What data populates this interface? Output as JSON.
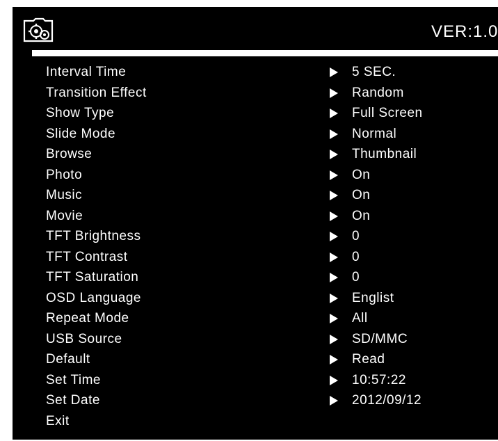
{
  "header": {
    "icon": "settings-gear-icon",
    "version_text": "VER:1.0"
  },
  "menu": {
    "items": [
      {
        "label": "Interval Time",
        "value": "5 SEC."
      },
      {
        "label": "Transition Effect",
        "value": "Random"
      },
      {
        "label": "Show Type",
        "value": "Full Screen"
      },
      {
        "label": "Slide Mode",
        "value": "Normal"
      },
      {
        "label": "Browse",
        "value": "Thumbnail"
      },
      {
        "label": "Photo",
        "value": "On"
      },
      {
        "label": "Music",
        "value": "On"
      },
      {
        "label": "Movie",
        "value": "On"
      },
      {
        "label": "TFT Brightness",
        "value": "0"
      },
      {
        "label": "TFT Contrast",
        "value": "0"
      },
      {
        "label": "TFT Saturation",
        "value": "0"
      },
      {
        "label": "OSD Language",
        "value": "Englist"
      },
      {
        "label": "Repeat Mode",
        "value": "All"
      },
      {
        "label": "USB Source",
        "value": "SD/MMC"
      },
      {
        "label": "Default",
        "value": "Read"
      },
      {
        "label": "Set Time",
        "value": "10:57:22"
      },
      {
        "label": "Set Date",
        "value": "2012/09/12"
      },
      {
        "label": "Exit",
        "value": ""
      }
    ]
  },
  "colors": {
    "background": "#000000",
    "text": "#ffffff"
  }
}
